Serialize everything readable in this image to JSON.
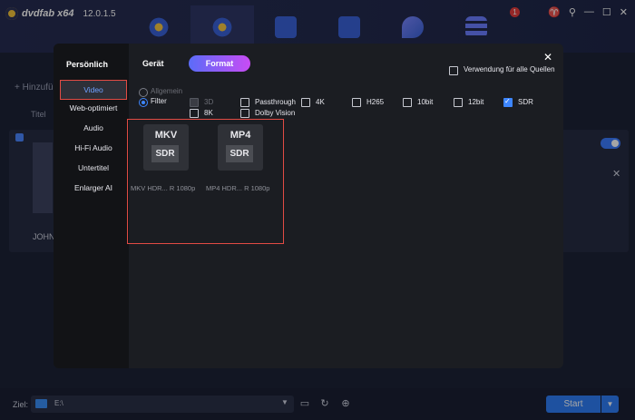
{
  "app": {
    "logo_text": "dvdfab x64",
    "version": "12.0.1.5",
    "notification_count": "1",
    "window_controls": [
      "♈",
      "⚲",
      "—",
      "☐",
      "✕"
    ]
  },
  "background": {
    "add_label": "+ Hinzufü",
    "title_column": "Titel",
    "item_name": "JOHN",
    "destination_label": "Ziel:",
    "destination_value": "E:\\",
    "start_label": "Start"
  },
  "dialog": {
    "personal_label": "Persönlich",
    "nav_items": [
      "Video",
      "Web-optimiert",
      "Audio",
      "Hi-Fi Audio",
      "Untertitel",
      "Enlarger AI"
    ],
    "tabs": {
      "device": "Gerät",
      "format": "Format"
    },
    "apply_all_label": "Verwendung für alle Quellen",
    "radio_general": "Allgemein",
    "radio_filter": "Filter",
    "filters": {
      "f3d": "3D",
      "f8k": "8K",
      "passthrough": "Passthrough",
      "dolby": "Dolby Vision",
      "f4k": "4K",
      "h265": "H265",
      "bit10": "10bit",
      "bit12": "12bit",
      "sdr": "SDR"
    },
    "formats": [
      {
        "top": "MKV",
        "badge": "SDR",
        "label": "MKV HDR... R 1080p"
      },
      {
        "top": "MP4",
        "badge": "SDR",
        "label": "MP4 HDR... R 1080p"
      }
    ]
  },
  "colors": {
    "accent": "#3d86ff",
    "highlight": "#e14b44",
    "format_gradient_start": "#5b6cf8",
    "format_gradient_end": "#c84cf4"
  }
}
